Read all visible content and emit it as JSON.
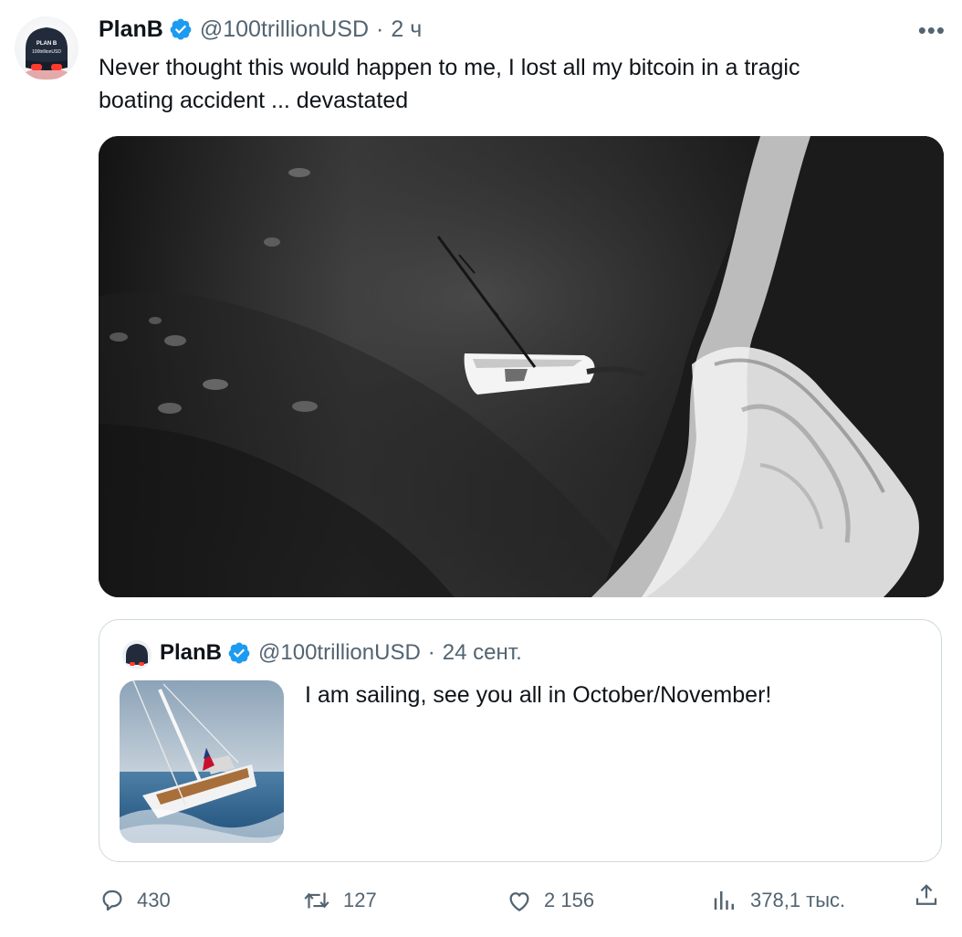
{
  "tweet": {
    "author_name": "PlanB",
    "handle": "@100trillionUSD",
    "time": "2 ч",
    "text_line1": "Never thought this would happen to me, I lost all my bitcoin in a tragic",
    "text_line2": "boating accident ... devastated",
    "avatar_text_top": "PLAN B",
    "avatar_text_bottom": "100trillionUSD"
  },
  "quote": {
    "author_name": "PlanB",
    "handle": "@100trillionUSD",
    "time": "24 сент.",
    "text": "I am sailing, see you all in October/November!"
  },
  "actions": {
    "replies": "430",
    "retweets": "127",
    "likes": "2 156",
    "views": "378,1 тыс."
  },
  "icons": {
    "verified": "verified-badge-icon",
    "more": "more-icon",
    "reply": "reply-icon",
    "retweet": "retweet-icon",
    "like": "heart-icon",
    "views": "views-icon",
    "share": "share-icon"
  },
  "colors": {
    "text": "#0f1419",
    "muted": "#536471",
    "verified": "#1d9bf0",
    "border": "#cfd9de"
  }
}
